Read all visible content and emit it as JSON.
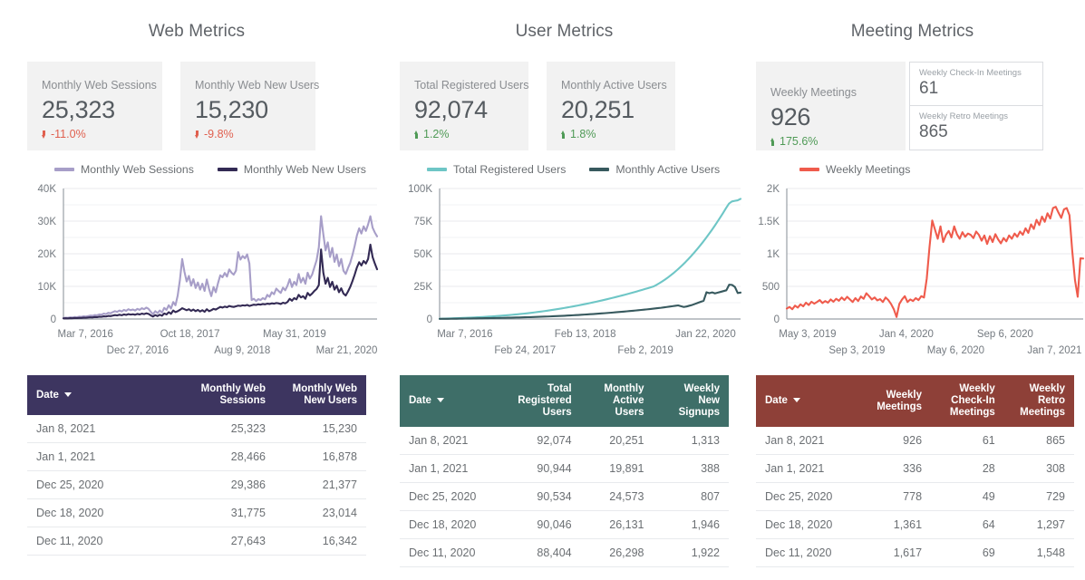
{
  "panels": [
    {
      "id": "web",
      "title": "Web Metrics",
      "accent": "#3d3560",
      "kpis": [
        {
          "label": "Monthly Web Sessions",
          "value": "25,323",
          "delta": "-11.0%",
          "direction": "down"
        },
        {
          "label": "Monthly Web New Users",
          "value": "15,230",
          "delta": "-9.8%",
          "direction": "down"
        }
      ],
      "legend": [
        {
          "label": "Monthly Web Sessions",
          "color": "#a79ec8"
        },
        {
          "label": "Monthly Web New Users",
          "color": "#332a54"
        }
      ],
      "table": {
        "columns": [
          "Date",
          "Monthly Web Sessions",
          "Monthly Web New Users"
        ],
        "sort_column": "Date",
        "rows": [
          [
            "Jan 8, 2021",
            "25,323",
            "15,230"
          ],
          [
            "Jan 1, 2021",
            "28,466",
            "16,878"
          ],
          [
            "Dec 25, 2020",
            "29,386",
            "21,377"
          ],
          [
            "Dec 18, 2020",
            "31,775",
            "23,014"
          ],
          [
            "Dec 11, 2020",
            "27,643",
            "16,342"
          ]
        ]
      }
    },
    {
      "id": "user",
      "title": "User Metrics",
      "accent": "#3e6e68",
      "kpis": [
        {
          "label": "Total Registered Users",
          "value": "92,074",
          "delta": "1.2%",
          "direction": "up"
        },
        {
          "label": "Monthly Active Users",
          "value": "20,251",
          "delta": "1.8%",
          "direction": "up"
        }
      ],
      "legend": [
        {
          "label": "Total Registered Users",
          "color": "#6ec6c6"
        },
        {
          "label": "Monthly Active Users",
          "color": "#37595e"
        }
      ],
      "table": {
        "columns": [
          "Date",
          "Total Registered Users",
          "Monthly Active Users",
          "Weekly New Signups"
        ],
        "sort_column": "Date",
        "rows": [
          [
            "Jan 8, 2021",
            "92,074",
            "20,251",
            "1,313"
          ],
          [
            "Jan 1, 2021",
            "90,944",
            "19,891",
            "388"
          ],
          [
            "Dec 25, 2020",
            "90,534",
            "24,573",
            "807"
          ],
          [
            "Dec 18, 2020",
            "90,046",
            "26,131",
            "1,946"
          ],
          [
            "Dec 11, 2020",
            "88,404",
            "26,298",
            "1,922"
          ]
        ]
      }
    },
    {
      "id": "meeting",
      "title": "Meeting Metrics",
      "accent": "#8e4038",
      "kpis": [
        {
          "label": "Weekly Meetings",
          "value": "926",
          "delta": "175.6%",
          "direction": "up"
        }
      ],
      "mini_kpis": [
        {
          "label": "Weekly Check-In Meetings",
          "value": "61"
        },
        {
          "label": "Weekly Retro Meetings",
          "value": "865"
        }
      ],
      "legend": [
        {
          "label": "Weekly Meetings",
          "color": "#ef5b4c"
        }
      ],
      "table": {
        "columns": [
          "Date",
          "Weekly Meetings",
          "Weekly Check-In Meetings",
          "Weekly Retro Meetings"
        ],
        "sort_column": "Date",
        "rows": [
          [
            "Jan 8, 2021",
            "926",
            "61",
            "865"
          ],
          [
            "Jan 1, 2021",
            "336",
            "28",
            "308"
          ],
          [
            "Dec 25, 2020",
            "778",
            "49",
            "729"
          ],
          [
            "Dec 18, 2020",
            "1,361",
            "64",
            "1,297"
          ],
          [
            "Dec 11, 2020",
            "1,617",
            "69",
            "1,548"
          ]
        ]
      }
    }
  ],
  "chart_data": [
    {
      "type": "line",
      "title": "Web Metrics",
      "xlabel": "",
      "ylabel": "",
      "ylim": [
        0,
        40000
      ],
      "yticks": [
        0,
        10000,
        20000,
        30000,
        40000
      ],
      "ytick_labels": [
        "0",
        "10K",
        "20K",
        "30K",
        "40K"
      ],
      "xtick_labels": [
        "Mar 7, 2016",
        "Dec 27, 2016",
        "Oct 18, 2017",
        "Aug 9, 2018",
        "May 31, 2019",
        "Mar 21, 2020"
      ],
      "grid": true,
      "legend_position": "top",
      "series": [
        {
          "name": "Monthly Web Sessions",
          "color": "#a79ec8",
          "values": [
            300,
            420,
            380,
            520,
            460,
            610,
            540,
            700,
            650,
            820,
            760,
            900,
            1050,
            980,
            1200,
            1150,
            1400,
            1320,
            1650,
            1500,
            1900,
            1750,
            2100,
            2400,
            2200,
            2600,
            2300,
            2800,
            2500,
            3000,
            2700,
            2900,
            2600,
            3100,
            2800,
            3300,
            3000,
            3500,
            3100,
            2200,
            1500,
            2400,
            1800,
            2600,
            2000,
            3400,
            2800,
            4200,
            3200,
            5200,
            4200,
            7200,
            12000,
            18400,
            14500,
            11500,
            13200,
            10200,
            12200,
            9500,
            11200,
            9000,
            10800,
            8600,
            12100,
            9200,
            7000,
            9800,
            8200,
            11000,
            13400,
            12800,
            14100,
            13000,
            15200,
            14200,
            13600,
            14800,
            20500,
            18200,
            19300,
            18600,
            19800,
            17000,
            5800,
            6200,
            5500,
            6100,
            5800,
            6400,
            6000,
            7400,
            6800,
            8200,
            7600,
            9300,
            8600,
            8000,
            9600,
            8800,
            10200,
            12200,
            9800,
            11400,
            10400,
            13800,
            11200,
            12600,
            10800,
            14200,
            12400,
            13600,
            15800,
            18000,
            22000,
            31500,
            26000,
            21000,
            23500,
            19000,
            21800,
            17500,
            19800,
            16200,
            18400,
            14800,
            13800,
            15600,
            17200,
            19600,
            22400,
            25600,
            27800,
            26200,
            28400,
            27000,
            29000,
            31500,
            28000,
            26500,
            25323
          ]
        },
        {
          "name": "Monthly Web New Users",
          "color": "#332a54",
          "values": [
            180,
            220,
            200,
            260,
            240,
            300,
            280,
            340,
            320,
            400,
            380,
            450,
            520,
            480,
            600,
            560,
            700,
            660,
            820,
            760,
            950,
            880,
            1050,
            1200,
            1100,
            1300,
            1150,
            1400,
            1250,
            1500,
            1350,
            1450,
            1300,
            1550,
            1400,
            1650,
            1500,
            1750,
            1550,
            1100,
            750,
            1200,
            900,
            1300,
            1000,
            1700,
            1400,
            2100,
            1600,
            2600,
            2100,
            2400,
            2800,
            3300,
            3000,
            2700,
            3000,
            2500,
            2900,
            2400,
            2800,
            2300,
            2700,
            2200,
            3000,
            2400,
            2700,
            3100,
            2900,
            3300,
            3700,
            3500,
            3800,
            3600,
            4000,
            3800,
            3700,
            3900,
            4100,
            4000,
            4200,
            4100,
            4300,
            4000,
            4200,
            4400,
            4300,
            4500,
            4400,
            4600,
            4500,
            4700,
            4600,
            4800,
            4700,
            4900,
            4800,
            4600,
            5000,
            4800,
            5200,
            6200,
            5600,
            6400,
            6000,
            7400,
            6600,
            7000,
            6200,
            8000,
            7200,
            7800,
            8600,
            9200,
            10400,
            21300,
            14200,
            10800,
            12600,
            9800,
            11400,
            9000,
            10200,
            8200,
            9400,
            7800,
            7200,
            8400,
            9800,
            11600,
            13600,
            15800,
            17400,
            16400,
            17800,
            17000,
            18400,
            22800,
            19000,
            17000,
            15230
          ]
        }
      ]
    },
    {
      "type": "line",
      "title": "User Metrics",
      "xlabel": "",
      "ylabel": "",
      "ylim": [
        0,
        100000
      ],
      "yticks": [
        0,
        25000,
        50000,
        75000,
        100000
      ],
      "ytick_labels": [
        "0",
        "25K",
        "50K",
        "75K",
        "100K"
      ],
      "xtick_labels": [
        "Mar 7, 2016",
        "Feb 24, 2017",
        "Feb 13, 2018",
        "Feb 2, 2019",
        "Jan 22, 2020"
      ],
      "grid": true,
      "legend_position": "top",
      "series": [
        {
          "name": "Total Registered Users",
          "color": "#6ec6c6",
          "values": [
            200,
            260,
            320,
            400,
            480,
            560,
            640,
            720,
            800,
            900,
            1000,
            1100,
            1200,
            1320,
            1440,
            1560,
            1700,
            1840,
            1980,
            2140,
            2300,
            2460,
            2640,
            2820,
            3000,
            3200,
            3400,
            3620,
            3840,
            4080,
            4320,
            4580,
            4840,
            5120,
            5400,
            5700,
            6000,
            6320,
            6640,
            6980,
            7320,
            7680,
            8040,
            8420,
            8800,
            9200,
            9600,
            10020,
            10440,
            10880,
            11320,
            11780,
            12240,
            12720,
            13200,
            13700,
            14200,
            14720,
            15240,
            15780,
            16320,
            16880,
            17440,
            18020,
            18600,
            19200,
            19800,
            20420,
            21040,
            21680,
            22320,
            22980,
            23640,
            24320,
            25000,
            26200,
            27500,
            28900,
            30400,
            32000,
            33700,
            35500,
            37400,
            39400,
            41500,
            43700,
            46000,
            48400,
            50900,
            53500,
            56200,
            59000,
            61900,
            64900,
            68000,
            71200,
            74500,
            77900,
            81400,
            85000,
            88400,
            90046,
            90534,
            90944,
            92074
          ]
        },
        {
          "name": "Monthly Active Users",
          "color": "#37595e",
          "values": [
            80,
            100,
            120,
            150,
            180,
            210,
            240,
            270,
            300,
            340,
            380,
            420,
            460,
            500,
            540,
            580,
            620,
            660,
            700,
            740,
            780,
            820,
            870,
            920,
            970,
            1020,
            1080,
            1140,
            1200,
            1260,
            1320,
            1380,
            1450,
            1520,
            1600,
            1680,
            1760,
            1840,
            1920,
            2000,
            2100,
            2200,
            2300,
            2400,
            2500,
            2620,
            2740,
            2860,
            2980,
            3100,
            3240,
            3380,
            3520,
            3660,
            3800,
            3960,
            4120,
            4280,
            4440,
            4600,
            4780,
            4960,
            5140,
            5320,
            5500,
            5700,
            5900,
            6100,
            6300,
            6500,
            6720,
            6940,
            7160,
            7380,
            7600,
            7850,
            8100,
            8350,
            8600,
            8900,
            9200,
            9500,
            9800,
            10100,
            10400,
            9800,
            9200,
            9600,
            10200,
            10800,
            11600,
            12400,
            13200,
            14000,
            20500,
            19800,
            20400,
            19600,
            20200,
            20800,
            21400,
            22000,
            26298,
            26131,
            24573,
            19891,
            20251
          ]
        }
      ]
    },
    {
      "type": "line",
      "title": "Meeting Metrics",
      "xlabel": "",
      "ylabel": "",
      "ylim": [
        0,
        2000
      ],
      "yticks": [
        0,
        500,
        1000,
        1500,
        2000
      ],
      "ytick_labels": [
        "0",
        "500",
        "1K",
        "1.5K",
        "2K"
      ],
      "xtick_labels": [
        "May 3, 2019",
        "Sep 3, 2019",
        "Jan 4, 2020",
        "May 6, 2020",
        "Sep 6, 2020",
        "Jan 7, 2021"
      ],
      "grid": true,
      "legend_position": "top",
      "series": [
        {
          "name": "Weekly Meetings",
          "color": "#ef5b4c",
          "values": [
            160,
            185,
            150,
            205,
            175,
            225,
            195,
            250,
            215,
            265,
            235,
            260,
            290,
            245,
            275,
            250,
            300,
            265,
            310,
            280,
            330,
            290,
            340,
            300,
            260,
            320,
            275,
            345,
            310,
            395,
            350,
            300,
            330,
            285,
            305,
            260,
            330,
            290,
            230,
            150,
            30,
            230,
            300,
            350,
            260,
            300,
            275,
            320,
            290,
            350,
            330,
            620,
            1100,
            1510,
            1370,
            1230,
            1420,
            1180,
            1290,
            1350,
            1250,
            1420,
            1300,
            1230,
            1330,
            1260,
            1310,
            1290,
            1240,
            1340,
            1290,
            1200,
            1280,
            1150,
            1270,
            1180,
            1300,
            1220,
            1160,
            1240,
            1190,
            1280,
            1230,
            1310,
            1260,
            1340,
            1290,
            1390,
            1320,
            1450,
            1380,
            1520,
            1440,
            1570,
            1490,
            1620,
            1540,
            1700,
            1720,
            1630,
            1550,
            1680,
            1700,
            1590,
            1050,
            600,
            340,
            930,
            926
          ]
        }
      ]
    }
  ]
}
